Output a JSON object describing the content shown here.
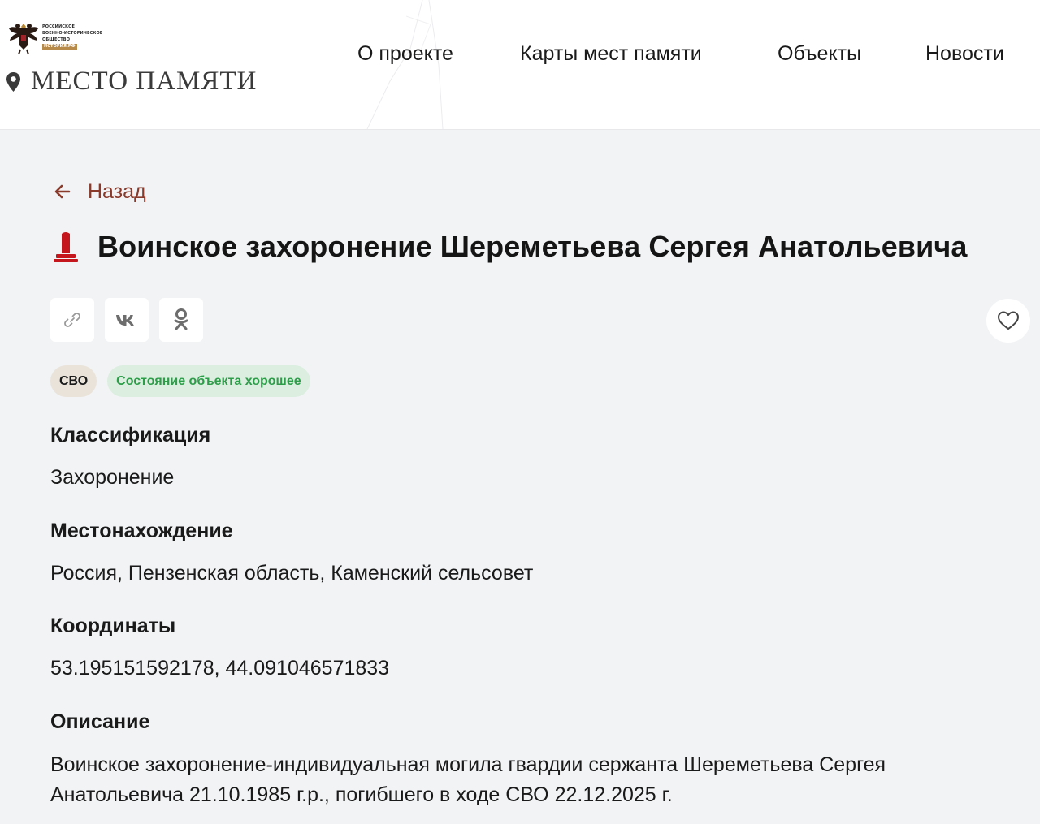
{
  "header": {
    "org_lines": [
      "Российское",
      "военно-историческое",
      "общество"
    ],
    "org_badge": "ИСТОРИЯ.РФ",
    "site_title": "МЕСТО ПАМЯТИ",
    "nav": [
      {
        "label": "О проекте"
      },
      {
        "label": "Карты мест памяти"
      },
      {
        "label": "Объекты"
      },
      {
        "label": "Новости"
      }
    ]
  },
  "page": {
    "back_label": "Назад",
    "title": "Воинское захоронение Шереметьева Сергея Анатольевича",
    "share_icons": [
      "link-icon",
      "vk-icon",
      "odnoklassniki-icon"
    ],
    "favorite_icon": "heart-icon",
    "tags": {
      "category": "СВО",
      "status": "Состояние объекта хорошее"
    },
    "fields": {
      "classification": {
        "label": "Классификация",
        "value": "Захоронение"
      },
      "location": {
        "label": "Местонахождение",
        "value": "Россия, Пензенская область, Каменский сельсовет"
      },
      "coordinates": {
        "label": "Координаты",
        "value": "53.195151592178, 44.091046571833"
      },
      "description": {
        "label": "Описание",
        "value": "Воинское захоронение-индивидуальная могила гвардии сержанта Шереметьева Сергея Анатольевича 21.10.1985 г.р., погибшего в ходе СВО 22.12.2025 г."
      }
    }
  },
  "colors": {
    "page_bg": "#f2f3f5",
    "accent_dark_red": "#8a3a2b",
    "monument_red": "#c4161c",
    "status_green": "#2e9d4a",
    "status_bg": "#dbeedf",
    "tag_bg": "#e9e3da"
  }
}
